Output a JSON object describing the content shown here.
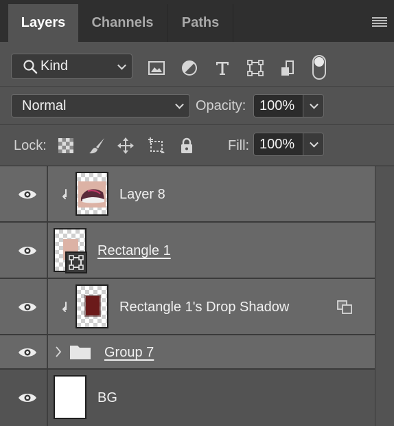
{
  "tabs": [
    {
      "label": "Layers",
      "active": true
    },
    {
      "label": "Channels",
      "active": false
    },
    {
      "label": "Paths",
      "active": false
    }
  ],
  "filter": {
    "kind_label": "Kind",
    "icons": [
      "image-filter-icon",
      "adjustment-filter-icon",
      "type-filter-icon",
      "shape-filter-icon",
      "smart-object-filter-icon"
    ]
  },
  "blend": {
    "mode": "Normal",
    "opacity_label": "Opacity:",
    "opacity_value": "100%"
  },
  "lock": {
    "label": "Lock:",
    "icons": [
      "lock-transparent-pixels-icon",
      "lock-image-pixels-icon",
      "lock-position-icon",
      "lock-artboard-icon",
      "lock-all-icon"
    ],
    "fill_label": "Fill:",
    "fill_value": "100%"
  },
  "layers": [
    {
      "name": "Layer 8",
      "clipped": true,
      "visible": true
    },
    {
      "name": "Rectangle 1",
      "clipped": false,
      "visible": true,
      "shape": true
    },
    {
      "name": "Rectangle 1's Drop Shadow",
      "clipped": true,
      "visible": true
    },
    {
      "name": "Group 7",
      "clipped": false,
      "visible": true,
      "group": true
    },
    {
      "name": "BG",
      "clipped": false,
      "visible": true
    }
  ],
  "colors": {
    "panel": "#535353",
    "tab_bar": "#2f2f2f",
    "selected_layer": "#686868",
    "shadow_thumb": "#6b1a1a",
    "rect_thumb": "#dcb2a5"
  }
}
